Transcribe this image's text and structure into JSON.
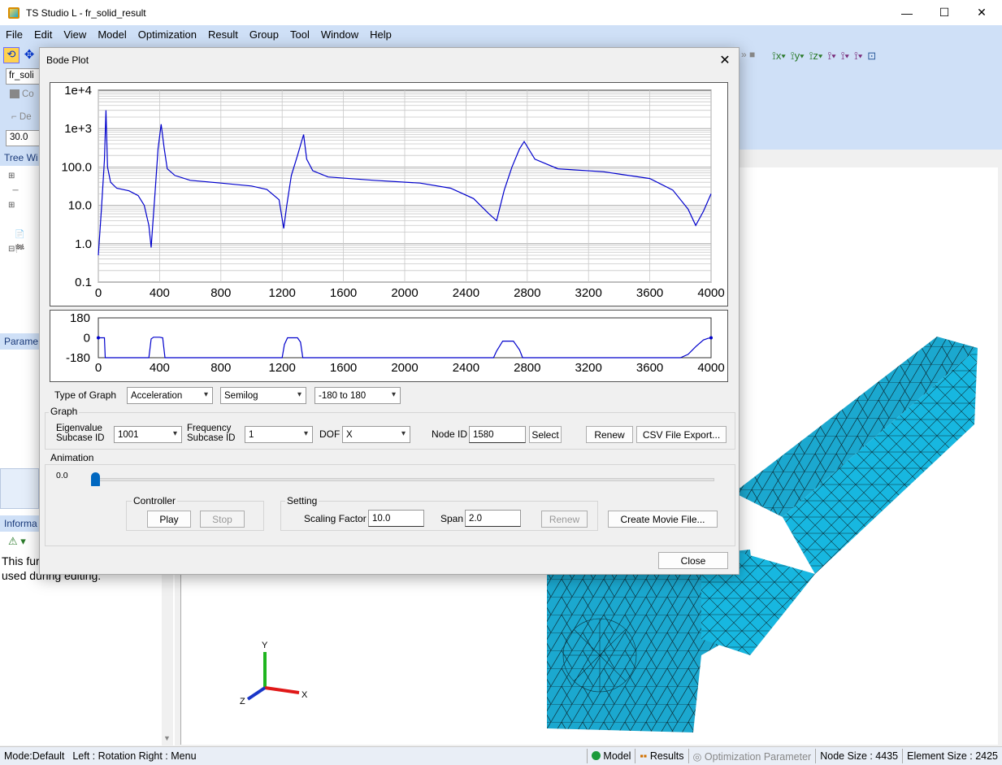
{
  "app": {
    "title": "TS Studio L - fr_solid_result",
    "menu": [
      "File",
      "Edit",
      "View",
      "Model",
      "Optimization",
      "Result",
      "Group",
      "Tool",
      "Window",
      "Help"
    ],
    "minimize_glyph": "—",
    "maximize_glyph": "☐",
    "close_glyph": "✕"
  },
  "left_panel": {
    "tree_field": "fr_soli",
    "coord_label": "Co",
    "de_label": "De",
    "angle_value": "30.0",
    "tree_header": "Tree Wi",
    "param_header": "Parame",
    "info_header": "Informa",
    "info_text_line1": "This fur",
    "info_text_line2": "used during editing."
  },
  "dialog": {
    "title": "Bode Plot",
    "type_of_graph_label": "Type of Graph",
    "type_value": "Acceleration",
    "scale_value": "Semilog",
    "phase_range_value": "-180 to 180",
    "graph_group": "Graph",
    "eigen_label_1": "Eigenvalue",
    "eigen_label_2": "Subcase ID",
    "eigen_value": "1001",
    "freq_label_1": "Frequency",
    "freq_label_2": "Subcase ID",
    "freq_value": "1",
    "dof_label": "DOF",
    "dof_value": "X",
    "node_label": "Node ID",
    "node_value": "1580",
    "select_btn": "Select",
    "renew_btn": "Renew",
    "csv_btn": "CSV File Export...",
    "animation_group": "Animation",
    "anim_value": "0.0",
    "controller_group": "Controller",
    "play_btn": "Play",
    "stop_btn": "Stop",
    "setting_group": "Setting",
    "scaling_label": "Scaling Factor",
    "scaling_value": "10.0",
    "span_label": "Span",
    "span_value": "2.0",
    "renew2_btn": "Renew",
    "movie_btn": "Create Movie File...",
    "close_btn": "Close"
  },
  "statusbar": {
    "mode": "Mode:Default",
    "mouse": "Left : Rotation Right : Menu",
    "model": "Model",
    "results": "Results",
    "opt": "Optimization Parameter",
    "node_size": "Node Size : 4435",
    "elem_size": "Element Size : 2425"
  },
  "colors": {
    "curve": "#0000cc",
    "mesh": "#1ba8cf",
    "menu_bg": "#cfe0f7"
  },
  "chart_data": [
    {
      "type": "line",
      "name": "magnitude",
      "y_scale": "log",
      "xlim": [
        0,
        4000
      ],
      "ylim": [
        0.1,
        10000
      ],
      "x_ticks": [
        "0",
        "400",
        "800",
        "1200",
        "1600",
        "2000",
        "2400",
        "2800",
        "3200",
        "3600",
        "4000"
      ],
      "y_ticks": [
        "1e+4",
        "1e+3",
        "100.0",
        "10.0",
        "1.0",
        "0.1"
      ],
      "grid": true,
      "series": [
        {
          "x": [
            0,
            20,
            40,
            50,
            55,
            60,
            80,
            120,
            200,
            260,
            300,
            330,
            345,
            355,
            370,
            390,
            410,
            430,
            450,
            500,
            600,
            800,
            1000,
            1100,
            1180,
            1210,
            1230,
            1260,
            1300,
            1340,
            1360,
            1400,
            1500,
            1800,
            2100,
            2300,
            2450,
            2550,
            2600,
            2650,
            2700,
            2750,
            2780,
            2850,
            3000,
            3300,
            3600,
            3750,
            3850,
            3900,
            3950,
            4000
          ],
          "y": [
            0.5,
            8,
            150,
            3000,
            500,
            100,
            40,
            28,
            24,
            18,
            10,
            3,
            0.8,
            3,
            20,
            300,
            1300,
            300,
            90,
            60,
            45,
            38,
            32,
            26,
            14,
            2.5,
            10,
            60,
            200,
            700,
            160,
            80,
            55,
            45,
            38,
            28,
            15,
            6,
            4,
            25,
            100,
            300,
            460,
            160,
            90,
            75,
            50,
            25,
            8,
            3,
            7,
            20
          ]
        }
      ]
    },
    {
      "type": "line",
      "name": "phase",
      "xlim": [
        0,
        4000
      ],
      "ylim": [
        -180,
        180
      ],
      "x_ticks": [
        "0",
        "400",
        "800",
        "1200",
        "1600",
        "2000",
        "2400",
        "2800",
        "3200",
        "3600",
        "4000"
      ],
      "y_ticks": [
        "180",
        "0",
        "-180"
      ],
      "series": [
        {
          "x": [
            0,
            30,
            40,
            45,
            50,
            330,
            345,
            360,
            400,
            420,
            435,
            1200,
            1215,
            1235,
            1300,
            1320,
            1335,
            2580,
            2600,
            2640,
            2710,
            2750,
            2770,
            3800,
            3850,
            3900,
            3950,
            3980,
            4000
          ],
          "y": [
            0,
            0,
            0,
            -180,
            -180,
            -180,
            -10,
            5,
            5,
            0,
            -180,
            -180,
            -60,
            0,
            0,
            -40,
            -180,
            -180,
            -120,
            -30,
            -30,
            -110,
            -180,
            -180,
            -150,
            -80,
            -20,
            -5,
            0
          ]
        }
      ]
    }
  ]
}
